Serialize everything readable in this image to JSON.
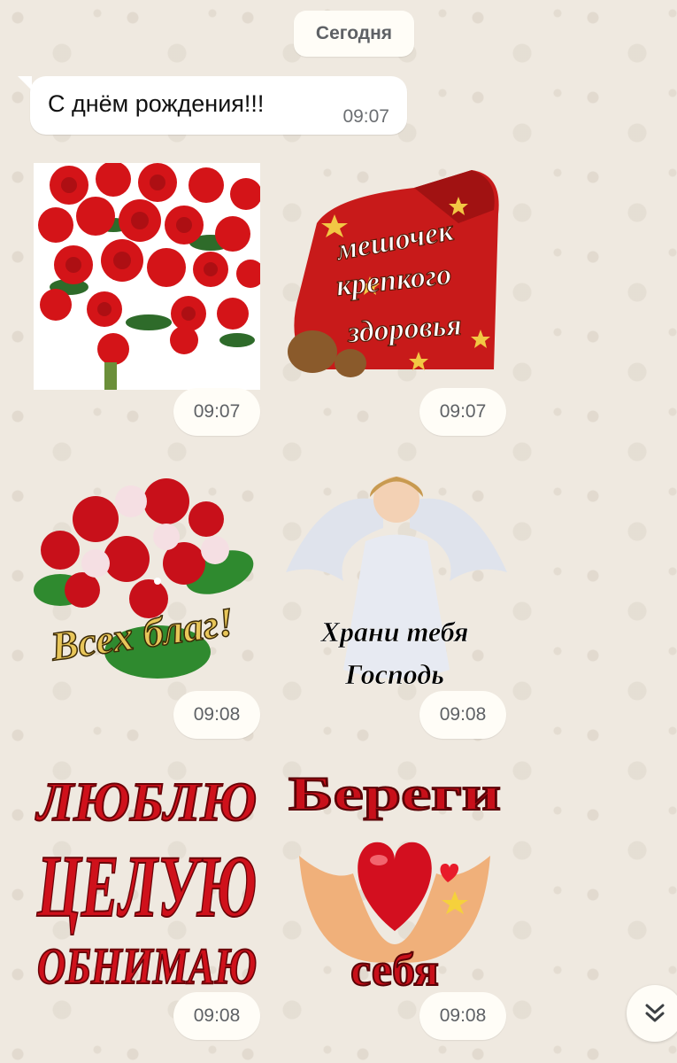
{
  "date_chip": "Сегодня",
  "message": {
    "text": "С днём рождения!!!",
    "time": "09:07"
  },
  "stickers": [
    {
      "id": "roses",
      "time": "09:07",
      "lines": []
    },
    {
      "id": "health-bag",
      "time": "09:07",
      "lines": [
        "мешочек",
        "крепкого",
        "здоровья"
      ]
    },
    {
      "id": "bouquet",
      "time": "09:08",
      "lines": [
        "Всех благ!"
      ]
    },
    {
      "id": "angel",
      "time": "09:08",
      "lines": [
        "Храни тебя",
        "Господь"
      ]
    },
    {
      "id": "love",
      "time": "09:08",
      "lines": [
        "ЛЮБЛЮ",
        "ЦЕЛУЮ",
        "ОБНИМАЮ"
      ]
    },
    {
      "id": "heart-hands",
      "time": "09:08",
      "lines": [
        "Береги",
        "себя"
      ]
    }
  ],
  "colors": {
    "background": "#efe9e0",
    "bubble": "#ffffff",
    "pill": "#fffdf7",
    "sticker_red": "#c8101a"
  },
  "icons": {
    "scroll_down": "double-chevron-down-icon"
  }
}
